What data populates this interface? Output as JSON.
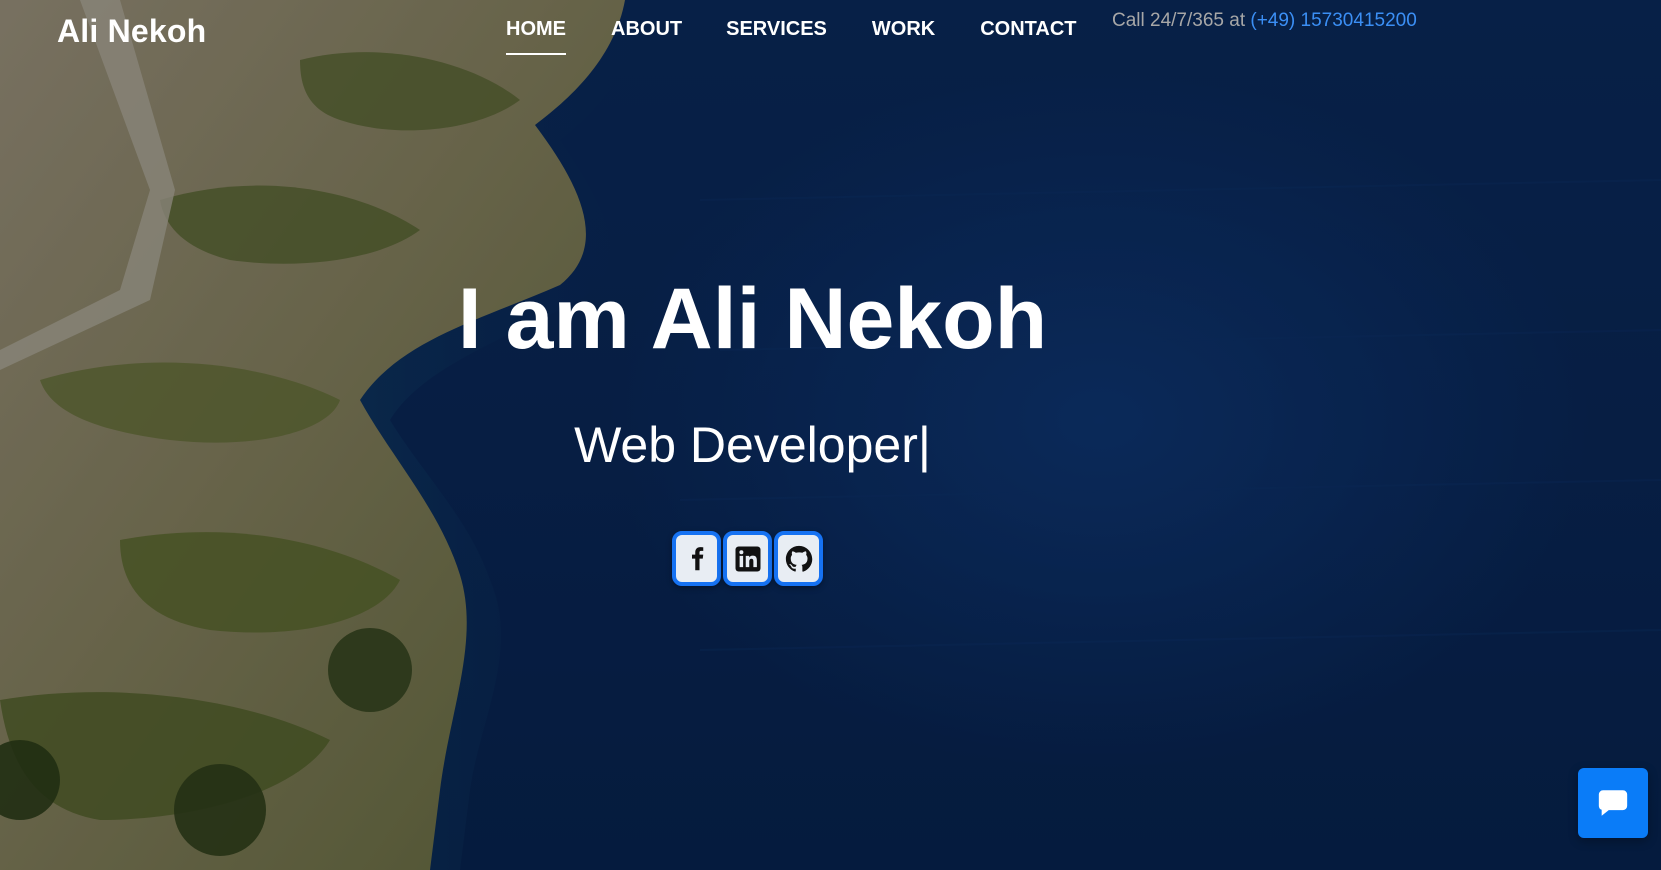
{
  "header": {
    "brand": "Ali Nekoh",
    "nav": [
      {
        "label": "HOME",
        "active": true
      },
      {
        "label": "ABOUT",
        "active": false
      },
      {
        "label": "SERVICES",
        "active": false
      },
      {
        "label": "WORK",
        "active": false
      },
      {
        "label": "CONTACT",
        "active": false
      }
    ],
    "call_prefix": "Call 24/7/365 at",
    "phone": "(+49) 15730415200"
  },
  "hero": {
    "title": "I am Ali Nekoh",
    "subtitle": "Web Developer",
    "cursor": "|"
  },
  "socials": [
    {
      "name": "facebook",
      "icon": "facebook-icon"
    },
    {
      "name": "linkedin",
      "icon": "linkedin-icon"
    },
    {
      "name": "github",
      "icon": "github-icon"
    }
  ],
  "chat": {
    "icon": "chat-bubble-icon"
  },
  "colors": {
    "accent": "#1672f2",
    "phone_link": "#3b8ff5",
    "call_text": "#a7a7a7",
    "water": "#0b2d63",
    "chat_button": "#0a7cf8"
  }
}
